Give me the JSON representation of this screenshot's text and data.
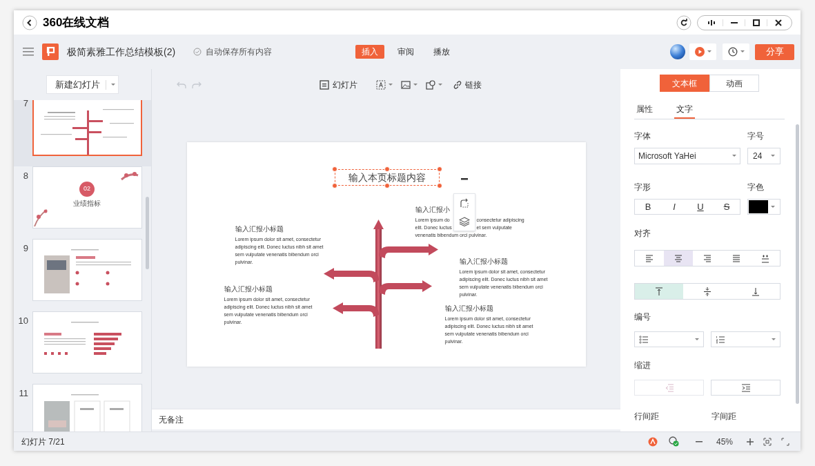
{
  "window": {
    "title": "360在线文档"
  },
  "toolbar": {
    "doc_title": "极简素雅工作总结模板(2)",
    "save_status": "自动保存所有内容",
    "tabs": [
      {
        "label": "插入",
        "selected": true
      },
      {
        "label": "审阅",
        "selected": false
      },
      {
        "label": "播放",
        "selected": false
      }
    ],
    "share_button": "分享"
  },
  "slide_panel": {
    "new_slide_button": "新建幻灯片",
    "slides": [
      {
        "number": "7",
        "selected": true,
        "kind": "arrows"
      },
      {
        "number": "8",
        "selected": false,
        "kind": "section",
        "badge": "02",
        "caption": "业绩指标"
      },
      {
        "number": "9",
        "selected": false,
        "kind": "photo_list"
      },
      {
        "number": "10",
        "selected": false,
        "kind": "bars"
      },
      {
        "number": "11",
        "selected": false,
        "kind": "photo_cards"
      }
    ]
  },
  "edit_toolbar": {
    "slide_button": "幻灯片",
    "link_button": "链接"
  },
  "slide": {
    "title": "输入本页标题内容",
    "blocks": [
      {
        "heading": "输入汇报小标题",
        "body": "Lorem ipsum dolor sit amet, consectetur adipiscing elit. Donec luctus nibh sit amet sem vulputate venenatis bibendum orci pulvinar."
      },
      {
        "heading": "输入汇报小",
        "kind": "covered",
        "lines": [
          [
            "Lorem ipsum do",
            "consectetur adipiscing"
          ],
          [
            "elit. Donec luctus",
            "et sem vulputate"
          ],
          [
            "venenatis bibendum orci pulvinar."
          ]
        ]
      },
      {
        "heading": "输入汇报小标题",
        "body": "Lorem ipsum dolor sit amet, consectetur adipiscing elit. Donec luctus nibh sit amet sem vulputate venenatis bibendum orci pulvinar."
      },
      {
        "heading": "输入汇报小标题",
        "body": "Lorem ipsum dolor sit amet, consectetur adipiscing elit. Donec luctus nibh sit amet sem vulputate venenatis bibendum orci pulvinar."
      },
      {
        "heading": "输入汇报小标题",
        "body": "Lorem ipsum dolor sit amet, consectetur adipiscing elit. Donec luctus nibh sit amet sem vulputate venenatis bibendum orci pulvinar."
      }
    ]
  },
  "notes": "无备注",
  "status_bar": {
    "slide_counter": "幻灯片 7/21",
    "zoom": "45%"
  },
  "format_panel": {
    "tabs": [
      {
        "label": "文本框",
        "selected": true
      },
      {
        "label": "动画",
        "selected": false
      }
    ],
    "subtabs": [
      {
        "label": "属性",
        "selected": false
      },
      {
        "label": "文字",
        "selected": true
      }
    ],
    "font_label": "字体",
    "font_value": "Microsoft YaHei",
    "size_label": "字号",
    "size_value": "24",
    "style_label": "字形",
    "style_buttons": [
      "B",
      "I",
      "U",
      "S"
    ],
    "color_label": "字色",
    "color": "#000000",
    "align_label": "对齐",
    "align": [
      {
        "kind": "left",
        "selected": false
      },
      {
        "kind": "center",
        "selected": true
      },
      {
        "kind": "right",
        "selected": false
      },
      {
        "kind": "justify",
        "selected": false
      },
      {
        "kind": "distribute",
        "selected": false
      }
    ],
    "valign": [
      {
        "kind": "top",
        "selected": true
      },
      {
        "kind": "middle",
        "selected": false
      },
      {
        "kind": "bottom",
        "selected": false
      }
    ],
    "numbering_label": "编号",
    "indent_label": "缩进",
    "line_spacing_label": "行间距",
    "char_spacing_label": "字间距"
  }
}
